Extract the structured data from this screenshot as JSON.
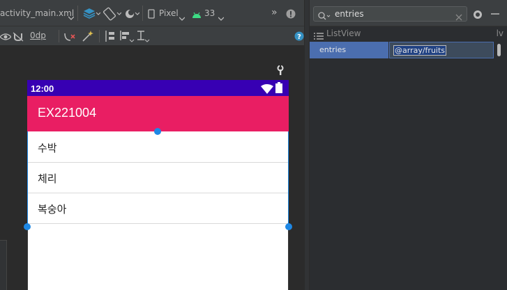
{
  "toolbar": {
    "file_tab": "activity_main.xml",
    "device": "Pixel",
    "api_level": "33",
    "margin_value": "0dp",
    "overflow": "»"
  },
  "phone": {
    "status_time": "12:00",
    "app_title": "EX221004",
    "list_items": [
      {
        "label": "수박"
      },
      {
        "label": "체리"
      },
      {
        "label": "복숭아"
      }
    ]
  },
  "attributes": {
    "search_query": "entries",
    "group_label": "ListView",
    "group_short": "lv",
    "attr_name": "entries",
    "attr_value": "@array/fruits"
  },
  "colors": {
    "status_bar": "#3700b3",
    "app_bar": "#e91e63",
    "selection_handle": "#1e88e5",
    "attr_selected": "#4b6eaf"
  },
  "icons": [
    "design-surface-icon",
    "orientation-icon",
    "theme-icon",
    "phone-icon",
    "android-icon",
    "warning-icon",
    "eye-icon",
    "magnet-icon",
    "clear-constraints-icon",
    "infer-constraints-icon",
    "pack-icon",
    "align-icon",
    "guidelines-icon",
    "help-icon",
    "wrench-icon",
    "search-icon",
    "clear-icon",
    "gear-icon",
    "list-icon",
    "wifi-icon",
    "battery-icon"
  ]
}
